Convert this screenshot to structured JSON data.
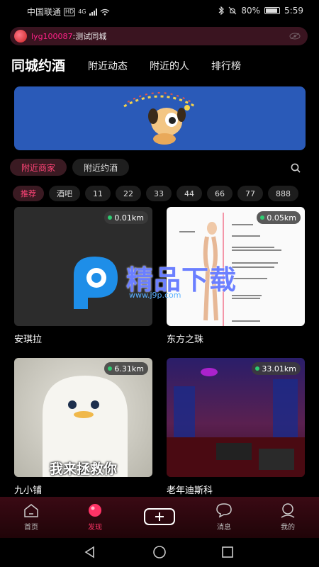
{
  "status": {
    "carrier": "中国联通",
    "hd": "HD",
    "net": "4G",
    "battery": "80%",
    "time": "5:59"
  },
  "notice": {
    "user": "lyg100087",
    "message": ":测试同城"
  },
  "header": {
    "tabs": [
      {
        "label": "同城约酒"
      },
      {
        "label": "附近动态"
      },
      {
        "label": "附近的人"
      },
      {
        "label": "排行榜"
      }
    ]
  },
  "filters": {
    "nearby_business": "附近商家",
    "nearby_drink": "附近约酒"
  },
  "categories": [
    "推荐",
    "酒吧",
    "11",
    "22",
    "33",
    "44",
    "66",
    "77",
    "888"
  ],
  "cards": [
    {
      "name": "安琪拉",
      "distance": "0.01km"
    },
    {
      "name": "东方之珠",
      "distance": "0.05km"
    },
    {
      "name": "九小铺",
      "distance": "6.31km",
      "caption": "我来拯救你"
    },
    {
      "name": "老年迪斯科",
      "distance": "33.01km"
    }
  ],
  "watermark": {
    "title": "精品下载",
    "url": "www.j9p.com"
  },
  "nav": [
    {
      "label": "首页"
    },
    {
      "label": "发现"
    },
    {
      "label": "消息"
    },
    {
      "label": "我的"
    }
  ],
  "colors": {
    "accent": "#ff3366",
    "background": "#000000"
  }
}
